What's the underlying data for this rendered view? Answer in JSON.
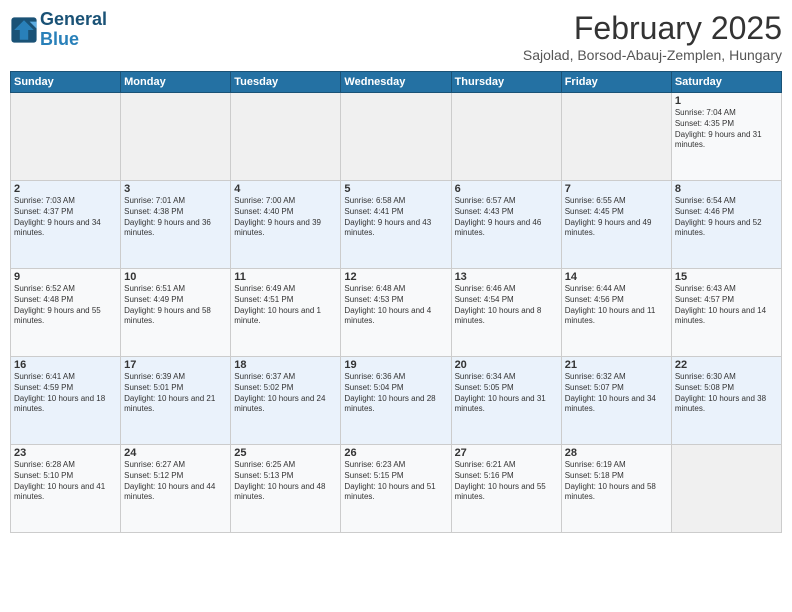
{
  "logo": {
    "line1": "General",
    "line2": "Blue"
  },
  "title": "February 2025",
  "subtitle": "Sajolad, Borsod-Abauj-Zemplen, Hungary",
  "weekdays": [
    "Sunday",
    "Monday",
    "Tuesday",
    "Wednesday",
    "Thursday",
    "Friday",
    "Saturday"
  ],
  "weeks": [
    [
      {
        "day": "",
        "info": ""
      },
      {
        "day": "",
        "info": ""
      },
      {
        "day": "",
        "info": ""
      },
      {
        "day": "",
        "info": ""
      },
      {
        "day": "",
        "info": ""
      },
      {
        "day": "",
        "info": ""
      },
      {
        "day": "1",
        "info": "Sunrise: 7:04 AM\nSunset: 4:35 PM\nDaylight: 9 hours and 31 minutes."
      }
    ],
    [
      {
        "day": "2",
        "info": "Sunrise: 7:03 AM\nSunset: 4:37 PM\nDaylight: 9 hours and 34 minutes."
      },
      {
        "day": "3",
        "info": "Sunrise: 7:01 AM\nSunset: 4:38 PM\nDaylight: 9 hours and 36 minutes."
      },
      {
        "day": "4",
        "info": "Sunrise: 7:00 AM\nSunset: 4:40 PM\nDaylight: 9 hours and 39 minutes."
      },
      {
        "day": "5",
        "info": "Sunrise: 6:58 AM\nSunset: 4:41 PM\nDaylight: 9 hours and 43 minutes."
      },
      {
        "day": "6",
        "info": "Sunrise: 6:57 AM\nSunset: 4:43 PM\nDaylight: 9 hours and 46 minutes."
      },
      {
        "day": "7",
        "info": "Sunrise: 6:55 AM\nSunset: 4:45 PM\nDaylight: 9 hours and 49 minutes."
      },
      {
        "day": "8",
        "info": "Sunrise: 6:54 AM\nSunset: 4:46 PM\nDaylight: 9 hours and 52 minutes."
      }
    ],
    [
      {
        "day": "9",
        "info": "Sunrise: 6:52 AM\nSunset: 4:48 PM\nDaylight: 9 hours and 55 minutes."
      },
      {
        "day": "10",
        "info": "Sunrise: 6:51 AM\nSunset: 4:49 PM\nDaylight: 9 hours and 58 minutes."
      },
      {
        "day": "11",
        "info": "Sunrise: 6:49 AM\nSunset: 4:51 PM\nDaylight: 10 hours and 1 minute."
      },
      {
        "day": "12",
        "info": "Sunrise: 6:48 AM\nSunset: 4:53 PM\nDaylight: 10 hours and 4 minutes."
      },
      {
        "day": "13",
        "info": "Sunrise: 6:46 AM\nSunset: 4:54 PM\nDaylight: 10 hours and 8 minutes."
      },
      {
        "day": "14",
        "info": "Sunrise: 6:44 AM\nSunset: 4:56 PM\nDaylight: 10 hours and 11 minutes."
      },
      {
        "day": "15",
        "info": "Sunrise: 6:43 AM\nSunset: 4:57 PM\nDaylight: 10 hours and 14 minutes."
      }
    ],
    [
      {
        "day": "16",
        "info": "Sunrise: 6:41 AM\nSunset: 4:59 PM\nDaylight: 10 hours and 18 minutes."
      },
      {
        "day": "17",
        "info": "Sunrise: 6:39 AM\nSunset: 5:01 PM\nDaylight: 10 hours and 21 minutes."
      },
      {
        "day": "18",
        "info": "Sunrise: 6:37 AM\nSunset: 5:02 PM\nDaylight: 10 hours and 24 minutes."
      },
      {
        "day": "19",
        "info": "Sunrise: 6:36 AM\nSunset: 5:04 PM\nDaylight: 10 hours and 28 minutes."
      },
      {
        "day": "20",
        "info": "Sunrise: 6:34 AM\nSunset: 5:05 PM\nDaylight: 10 hours and 31 minutes."
      },
      {
        "day": "21",
        "info": "Sunrise: 6:32 AM\nSunset: 5:07 PM\nDaylight: 10 hours and 34 minutes."
      },
      {
        "day": "22",
        "info": "Sunrise: 6:30 AM\nSunset: 5:08 PM\nDaylight: 10 hours and 38 minutes."
      }
    ],
    [
      {
        "day": "23",
        "info": "Sunrise: 6:28 AM\nSunset: 5:10 PM\nDaylight: 10 hours and 41 minutes."
      },
      {
        "day": "24",
        "info": "Sunrise: 6:27 AM\nSunset: 5:12 PM\nDaylight: 10 hours and 44 minutes."
      },
      {
        "day": "25",
        "info": "Sunrise: 6:25 AM\nSunset: 5:13 PM\nDaylight: 10 hours and 48 minutes."
      },
      {
        "day": "26",
        "info": "Sunrise: 6:23 AM\nSunset: 5:15 PM\nDaylight: 10 hours and 51 minutes."
      },
      {
        "day": "27",
        "info": "Sunrise: 6:21 AM\nSunset: 5:16 PM\nDaylight: 10 hours and 55 minutes."
      },
      {
        "day": "28",
        "info": "Sunrise: 6:19 AM\nSunset: 5:18 PM\nDaylight: 10 hours and 58 minutes."
      },
      {
        "day": "",
        "info": ""
      }
    ]
  ]
}
